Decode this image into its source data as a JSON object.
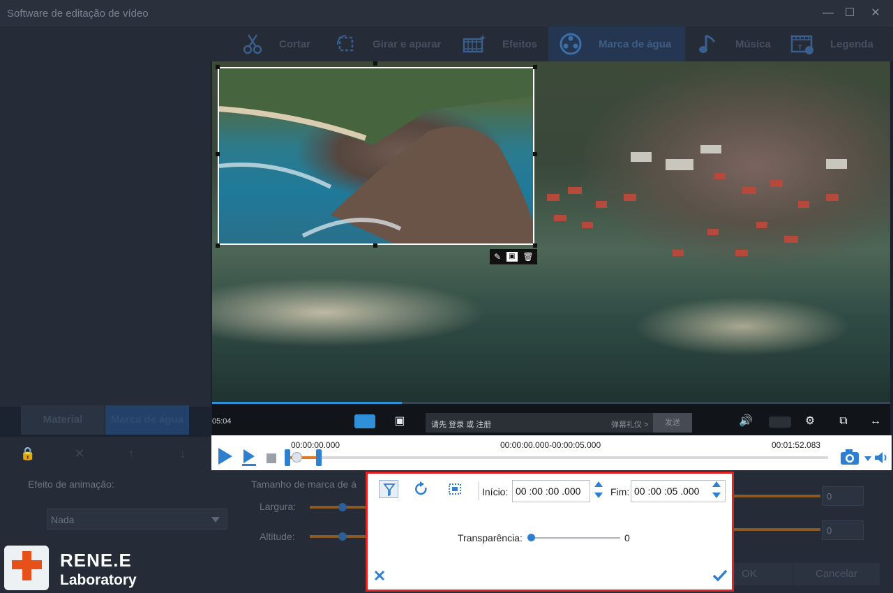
{
  "window": {
    "title": "Software de editação de vídeo",
    "controls": [
      "minimize",
      "maximize",
      "close"
    ]
  },
  "tabs": [
    {
      "label": "Cortar",
      "icon": "scissors-icon"
    },
    {
      "label": "Girar e aparar",
      "icon": "crop-rotate-icon"
    },
    {
      "label": "Efeitos",
      "icon": "effects-icon"
    },
    {
      "label": "Marca de água",
      "icon": "watermark-reel-icon",
      "active": true
    },
    {
      "label": "Música",
      "icon": "music-note-icon"
    },
    {
      "label": "Legenda",
      "icon": "subtitle-icon"
    }
  ],
  "left_panel": {
    "tabs": [
      {
        "label": "Material"
      },
      {
        "label": "Marca de água",
        "active": true
      }
    ],
    "tools": [
      "lock-icon",
      "close-icon",
      "arrow-up-icon",
      "arrow-down-icon"
    ]
  },
  "player": {
    "time": "05:04",
    "progress": 0.28,
    "promo_bar": {
      "left_text": "请先 登录 或 注册",
      "right_text": "弹幕礼仪 >",
      "send_label": "发送"
    }
  },
  "timeline": {
    "start_time": "00:00:00.000",
    "range_time": "00:00:00.000-00:00:05.000",
    "end_time": "00:01:52.083"
  },
  "settings": {
    "animation_label": "Efeito de animação:",
    "animation_value": "Nada",
    "size_label": "Tamanho de marca de á",
    "width_label": "Largura:",
    "height_label": "Altitude:",
    "width_value": "0",
    "height_value": "0",
    "ok_label": "OK",
    "cancel_label": "Cancelar"
  },
  "logo": {
    "line1": "RENE.E",
    "line2": "Laboratory"
  },
  "dialog": {
    "start_label": "Início:",
    "start_value": "00 :00 :00 .000",
    "end_label": "Fim:",
    "end_value": "00 :00 :05 .000",
    "transparency_label": "Transparência:",
    "transparency_value": "0"
  },
  "colors": {
    "accent": "#2f7fd0",
    "dialog_border": "#e02424",
    "timeline_selection": "#e8761f"
  }
}
